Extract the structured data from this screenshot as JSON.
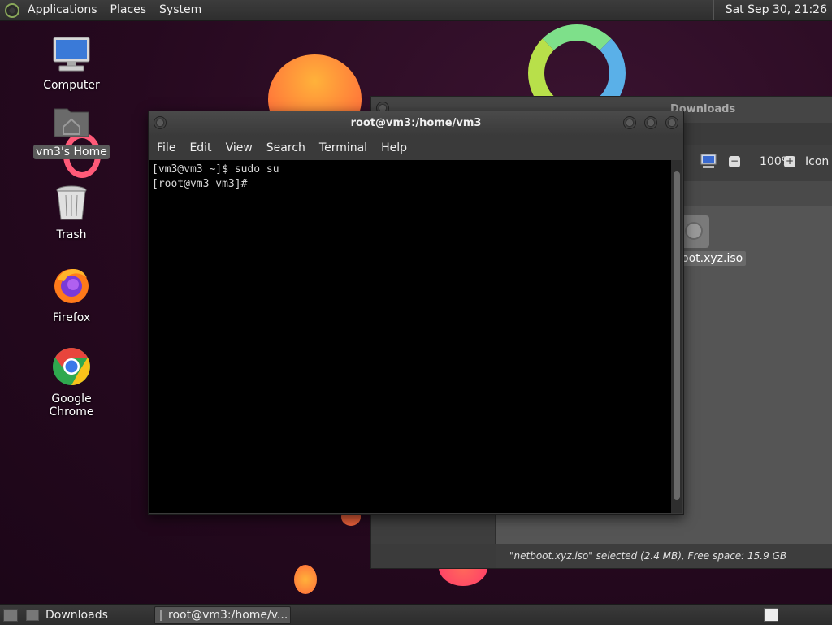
{
  "top_panel": {
    "menu": [
      "Applications",
      "Places",
      "System"
    ],
    "clock": "Sat Sep 30, 21:26"
  },
  "desktop": {
    "icons": [
      {
        "label": "Computer",
        "icon": "computer-icon"
      },
      {
        "label": "vm3's Home",
        "icon": "home-folder-icon",
        "selected": true
      },
      {
        "label": "Trash",
        "icon": "trash-icon"
      },
      {
        "label": "Firefox",
        "icon": "firefox-icon"
      },
      {
        "label": "Google Chrome",
        "icon": "chrome-icon"
      }
    ]
  },
  "file_manager": {
    "title": "Downloads",
    "zoom": "100%",
    "view_label": "Icon V",
    "file_label": "oot.xyz.iso",
    "status": "\"netboot.xyz.iso\" selected (2.4 MB), Free space: 15.9 GB"
  },
  "terminal": {
    "title": "root@vm3:/home/vm3",
    "menu": [
      "File",
      "Edit",
      "View",
      "Search",
      "Terminal",
      "Help"
    ],
    "lines": [
      "[vm3@vm3 ~]$ sudo su",
      "[root@vm3 vm3]#"
    ]
  },
  "bottom_panel": {
    "tasks": [
      {
        "label": "Downloads",
        "icon": "folder-icon",
        "active": false
      },
      {
        "label": "root@vm3:/home/v...",
        "icon": "terminal-icon",
        "active": true
      }
    ]
  },
  "colors": {
    "wallpaper": "#26091f",
    "panel": "#333333",
    "terminal_bg": "#000000"
  }
}
